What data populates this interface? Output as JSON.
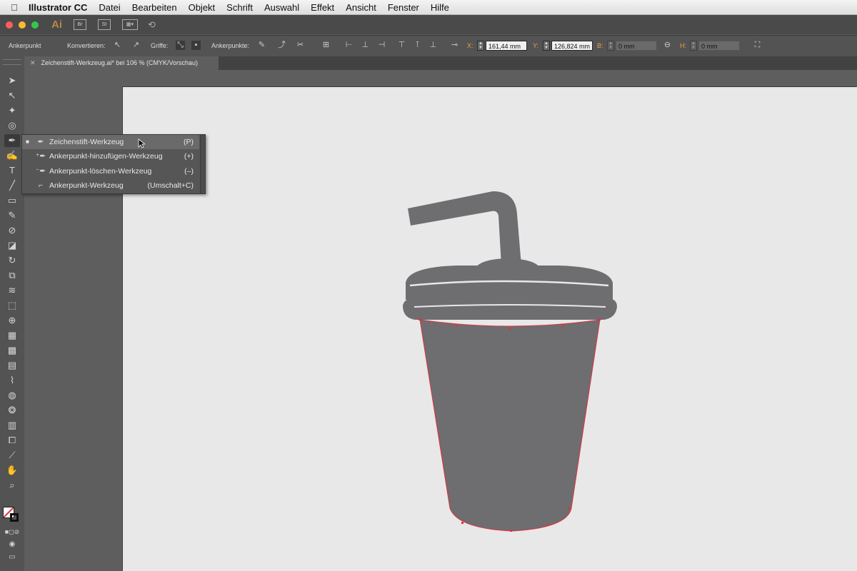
{
  "menubar": {
    "app_name": "Illustrator CC",
    "items": [
      "Datei",
      "Bearbeiten",
      "Objekt",
      "Schrift",
      "Auswahl",
      "Effekt",
      "Ansicht",
      "Fenster",
      "Hilfe"
    ]
  },
  "appbar": {
    "logo": "Ai",
    "bridge": "Br",
    "stock": "St",
    "traffic_colors": [
      "#fc5f57",
      "#fdbc2e",
      "#34c84a"
    ]
  },
  "controlbar": {
    "mode_label": "Ankerpunkt",
    "convert_label": "Konvertieren:",
    "handles_label": "Griffe:",
    "anchors_label": "Ankerpunkte:",
    "x_label": "X:",
    "x_value": "161,44 mm",
    "y_label": "Y:",
    "y_value": "126,824 mm",
    "w_label": "B:",
    "w_value": "0 mm",
    "h_label": "H:",
    "h_value": "0 mm"
  },
  "document": {
    "tab_title": "Zeichenstift-Werkzeug.ai* bei 106 % (CMYK/Vorschau)"
  },
  "flyout": {
    "items": [
      {
        "label": "Zeichenstift-Werkzeug",
        "shortcut": "(P)",
        "checked": true,
        "icon": "pen-icon"
      },
      {
        "label": "Ankerpunkt-hinzufügen-Werkzeug",
        "shortcut": "(+)",
        "checked": false,
        "icon": "add-anchor-icon"
      },
      {
        "label": "Ankerpunkt-löschen-Werkzeug",
        "shortcut": "(–)",
        "checked": false,
        "icon": "delete-anchor-icon"
      },
      {
        "label": "Ankerpunkt-Werkzeug",
        "shortcut": "(Umschalt+C)",
        "checked": false,
        "icon": "anchor-point-icon"
      }
    ]
  },
  "colors": {
    "artwork": "#6e6d70",
    "selection": "#e0323d",
    "artboard": "#e8e8e8"
  }
}
